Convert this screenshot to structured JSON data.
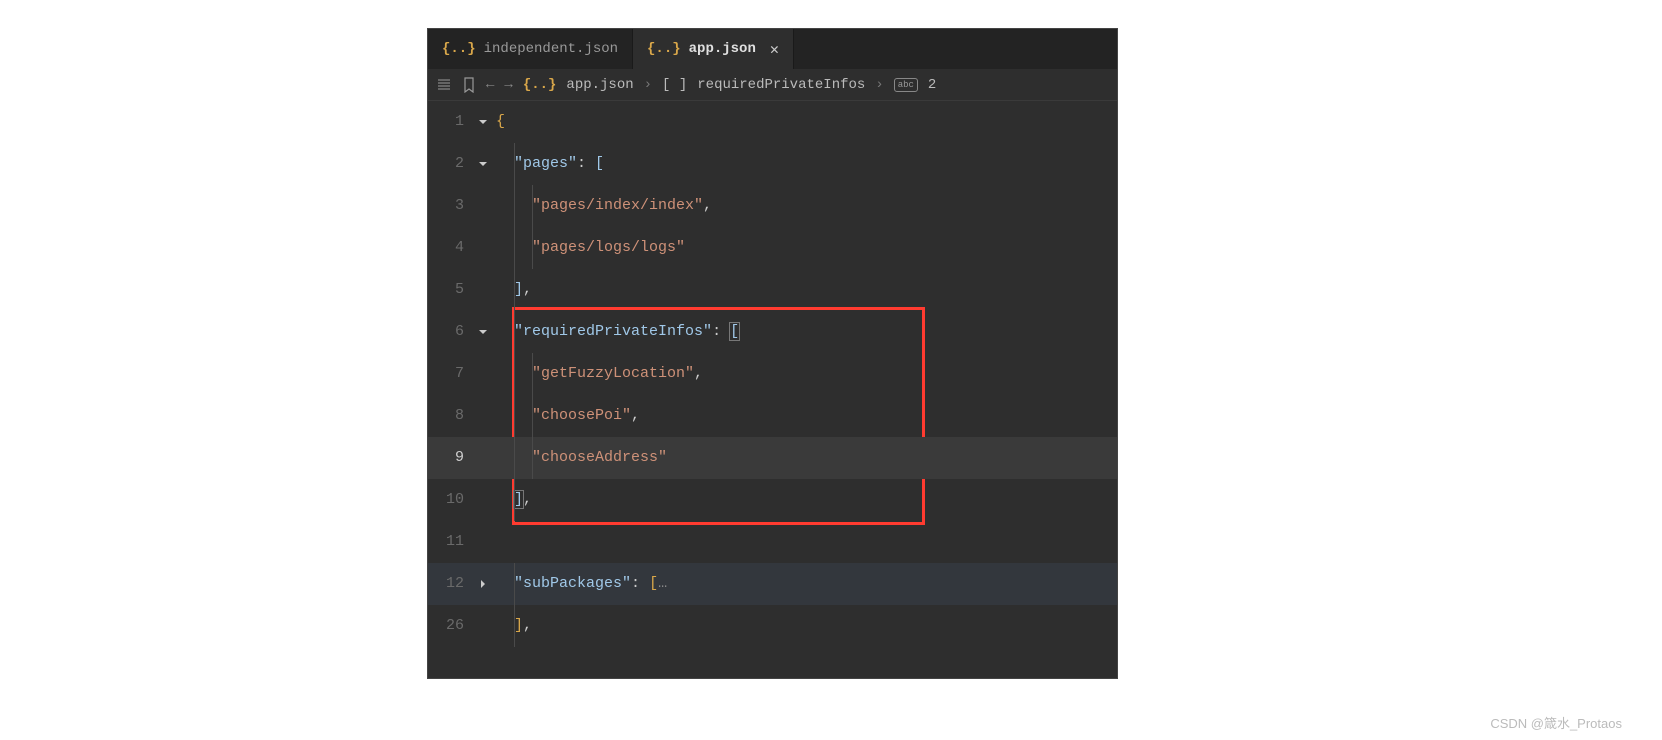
{
  "tabs": [
    {
      "icon": "{..}",
      "label": "independent.json",
      "active": false
    },
    {
      "icon": "{..}",
      "label": "app.json",
      "active": true
    }
  ],
  "breadcrumb": {
    "file_icon": "{..}",
    "file": "app.json",
    "array_icon": "[ ]",
    "path1": "requiredPrivateInfos",
    "abc": "abc",
    "path2": "2"
  },
  "code": {
    "lines": [
      {
        "n": "1",
        "fold": "v",
        "indent": 0,
        "tokens": [
          {
            "t": "brace",
            "v": "{"
          }
        ]
      },
      {
        "n": "2",
        "fold": "v",
        "indent": 1,
        "tokens": [
          {
            "t": "key",
            "v": "\"pages\""
          },
          {
            "t": "punct",
            "v": ": "
          },
          {
            "t": "bracket",
            "v": "["
          }
        ]
      },
      {
        "n": "3",
        "fold": "",
        "indent": 2,
        "tokens": [
          {
            "t": "string",
            "v": "\"pages/index/index\""
          },
          {
            "t": "punct",
            "v": ","
          }
        ]
      },
      {
        "n": "4",
        "fold": "",
        "indent": 2,
        "tokens": [
          {
            "t": "string",
            "v": "\"pages/logs/logs\""
          }
        ]
      },
      {
        "n": "5",
        "fold": "",
        "indent": 1,
        "tokens": [
          {
            "t": "bracket",
            "v": "]"
          },
          {
            "t": "punct",
            "v": ","
          }
        ]
      },
      {
        "n": "6",
        "fold": "v",
        "indent": 1,
        "tokens": [
          {
            "t": "key",
            "v": "\"requiredPrivateInfos\""
          },
          {
            "t": "punct",
            "v": ": "
          },
          {
            "t": "bracket",
            "v": "[",
            "match": true
          }
        ]
      },
      {
        "n": "7",
        "fold": "",
        "indent": 2,
        "tokens": [
          {
            "t": "string",
            "v": "\"getFuzzyLocation\""
          },
          {
            "t": "punct",
            "v": ","
          }
        ]
      },
      {
        "n": "8",
        "fold": "",
        "indent": 2,
        "tokens": [
          {
            "t": "string",
            "v": "\"choosePoi\""
          },
          {
            "t": "punct",
            "v": ","
          }
        ]
      },
      {
        "n": "9",
        "fold": "",
        "indent": 2,
        "current": true,
        "tokens": [
          {
            "t": "string",
            "v": "\"chooseAddress\""
          }
        ]
      },
      {
        "n": "10",
        "fold": "",
        "indent": 1,
        "tokens": [
          {
            "t": "bracket",
            "v": "]",
            "match": true
          },
          {
            "t": "punct",
            "v": ","
          }
        ]
      },
      {
        "n": "11",
        "fold": "",
        "indent": 0,
        "tokens": []
      },
      {
        "n": "12",
        "fold": ">",
        "indent": 1,
        "dim": true,
        "tokens": [
          {
            "t": "key",
            "v": "\"subPackages\""
          },
          {
            "t": "punct",
            "v": ": "
          },
          {
            "t": "bracket2",
            "v": "["
          },
          {
            "t": "ellipsis",
            "v": "…"
          }
        ]
      },
      {
        "n": "26",
        "fold": "",
        "indent": 1,
        "tokens": [
          {
            "t": "bracket2",
            "v": "]"
          },
          {
            "t": "punct",
            "v": ","
          }
        ]
      }
    ]
  },
  "watermark": "CSDN @箴水_Protaos"
}
